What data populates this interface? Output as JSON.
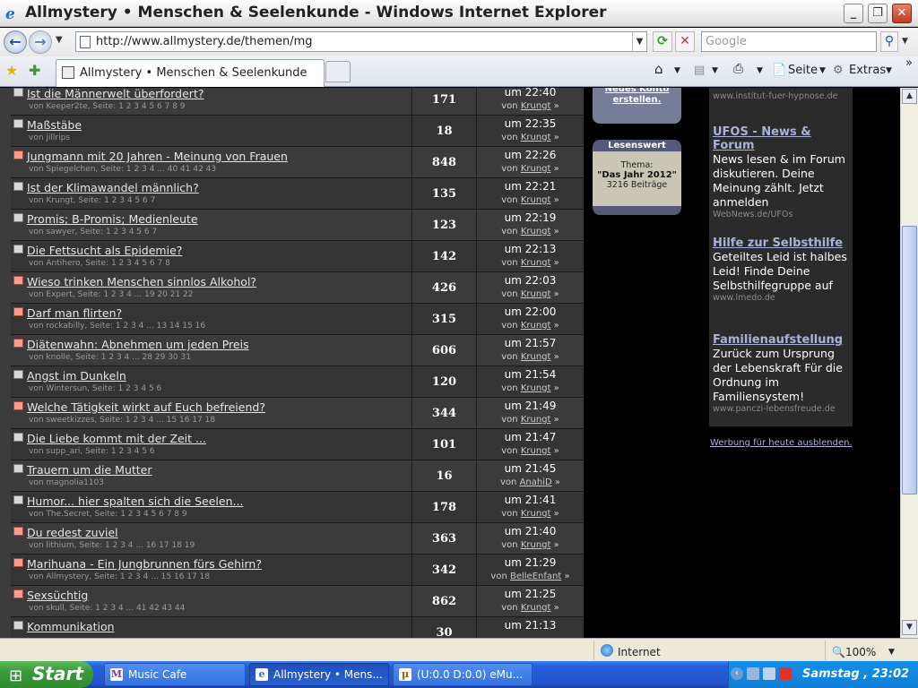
{
  "window": {
    "title": "Allmystery • Menschen & Seelenkunde - Windows Internet Explorer"
  },
  "address": {
    "url": "http://www.allmystery.de/themen/mg",
    "search_placeholder": "Google"
  },
  "tab": {
    "label": "Allmystery • Menschen & Seelenkunde"
  },
  "toolbar": {
    "page_label": "Seite",
    "extras_label": "Extras"
  },
  "threads": [
    {
      "title": "Ist die Männerwelt überfordert?",
      "sub": "von Keeper2te, Seite: 1 2 3 4 5 6 7 8 9",
      "count": "171",
      "time": "um 22:40",
      "by_prefix": "von",
      "by_user": "Krungt",
      "hot": false
    },
    {
      "title": "Maßstäbe",
      "sub": "von jillrips",
      "count": "18",
      "time": "um 22:35",
      "by_prefix": "von",
      "by_user": "Krungt",
      "hot": false
    },
    {
      "title": "Jungmann mit 20 Jahren - Meinung von Frauen",
      "sub": "von Spiegelchen, Seite: 1 2 3 4 ... 40 41 42 43",
      "count": "848",
      "time": "um 22:26",
      "by_prefix": "von",
      "by_user": "Krungt",
      "hot": true
    },
    {
      "title": "Ist der Klimawandel männlich?",
      "sub": "von Krungt, Seite: 1 2 3 4 5 6 7",
      "count": "135",
      "time": "um 22:21",
      "by_prefix": "von",
      "by_user": "Krungt",
      "hot": false
    },
    {
      "title": "Promis; B-Promis; Medienleute",
      "sub": "von sawyer, Seite: 1 2 3 4 5 6 7",
      "count": "123",
      "time": "um 22:19",
      "by_prefix": "von",
      "by_user": "Krungt",
      "hot": false
    },
    {
      "title": "Die Fettsucht als Epidemie?",
      "sub": "von Antihero, Seite: 1 2 3 4 5 6 7 8",
      "count": "142",
      "time": "um 22:13",
      "by_prefix": "von",
      "by_user": "Krungt",
      "hot": false
    },
    {
      "title": "Wieso trinken Menschen sinnlos Alkohol?",
      "sub": "von Expert, Seite: 1 2 3 4 ... 19 20 21 22",
      "count": "426",
      "time": "um 22:03",
      "by_prefix": "von",
      "by_user": "Krungt",
      "hot": true
    },
    {
      "title": "Darf man flirten?",
      "sub": "von rockabilly, Seite: 1 2 3 4 ... 13 14 15 16",
      "count": "315",
      "time": "um 22:00",
      "by_prefix": "von",
      "by_user": "Krungt",
      "hot": true
    },
    {
      "title": "Diätenwahn: Abnehmen um jeden Preis",
      "sub": "von knolle, Seite: 1 2 3 4 ... 28 29 30 31",
      "count": "606",
      "time": "um 21:57",
      "by_prefix": "von",
      "by_user": "Krungt",
      "hot": true
    },
    {
      "title": "Angst im Dunkeln",
      "sub": "von Wintersun, Seite: 1 2 3 4 5 6",
      "count": "120",
      "time": "um 21:54",
      "by_prefix": "von",
      "by_user": "Krungt",
      "hot": false
    },
    {
      "title": "Welche Tätigkeit wirkt auf Euch befreiend?",
      "sub": "von sweetkizzes, Seite: 1 2 3 4 ... 15 16 17 18",
      "count": "344",
      "time": "um 21:49",
      "by_prefix": "von",
      "by_user": "Krungt",
      "hot": true
    },
    {
      "title": "Die Liebe kommt mit der Zeit ...",
      "sub": "von supp_ari, Seite: 1 2 3 4 5 6",
      "count": "101",
      "time": "um 21:47",
      "by_prefix": "von",
      "by_user": "Krungt",
      "hot": false
    },
    {
      "title": "Trauern um die Mutter",
      "sub": "von magnolia1103",
      "count": "16",
      "time": "um 21:45",
      "by_prefix": "von",
      "by_user": "AnahiD",
      "hot": false
    },
    {
      "title": "Humor... hier spalten sich die Seelen...",
      "sub": "von The.Secret, Seite: 1 2 3 4 5 6 7 8 9",
      "count": "178",
      "time": "um 21:41",
      "by_prefix": "von",
      "by_user": "Krungt",
      "hot": false
    },
    {
      "title": "Du redest zuviel",
      "sub": "von lithium, Seite: 1 2 3 4 ... 16 17 18 19",
      "count": "363",
      "time": "um 21:40",
      "by_prefix": "von",
      "by_user": "Krungt",
      "hot": true
    },
    {
      "title": "Marihuana - Ein Jungbrunnen fürs Gehirn?",
      "sub": "von Allmystery, Seite: 1 2 3 4 ... 15 16 17 18",
      "count": "342",
      "time": "um 21:29",
      "by_prefix": "von",
      "by_user": "BelleEnfant",
      "hot": true
    },
    {
      "title": "Sexsüchtig",
      "sub": "von skull, Seite: 1 2 3 4 ... 41 42 43 44",
      "count": "862",
      "time": "um 21:25",
      "by_prefix": "von",
      "by_user": "Krungt",
      "hot": true
    },
    {
      "title": "Kommunikation",
      "sub": "",
      "count": "30",
      "time": "um 21:13",
      "by_prefix": "",
      "by_user": "",
      "hot": false
    }
  ],
  "new_account": {
    "line1": "Neues Konto",
    "line2": "erstellen."
  },
  "lesenswert": {
    "header": "Lesenswert",
    "thema": "Thema:",
    "title": "\"Das Jahr 2012\"",
    "count": "3216 Beiträge"
  },
  "ads": [
    {
      "url": "www.institut-fuer-hypnose.de"
    },
    {
      "head": "UFOS - News & Forum",
      "text": "News lesen & im Forum diskutieren. Deine Meinung zählt. Jetzt anmelden",
      "url": "WebNews.de/UFOs"
    },
    {
      "head": "Hilfe zur Selbsthilfe",
      "text": "Geteiltes Leid ist halbes Leid! Finde Deine Selbsthilfegruppe auf",
      "url": "www.lmedo.de"
    },
    {
      "head": "Familienaufstellung",
      "text": "Zurück zum Ursprung der Lebenskraft Für die Ordnung im Familiensystem!",
      "url": "www.panczi-lebensfreude.de"
    }
  ],
  "ad_hide_link": "Werbung für heute ausblenden.",
  "status": {
    "zone": "Internet",
    "zoom": "100%"
  },
  "taskbar": {
    "start": "Start",
    "tasks": [
      "Music Cafe",
      "Allmystery • Mens...",
      "(U:0.0 D:0.0) eMu..."
    ],
    "clock": "Samstag , 23:02"
  }
}
